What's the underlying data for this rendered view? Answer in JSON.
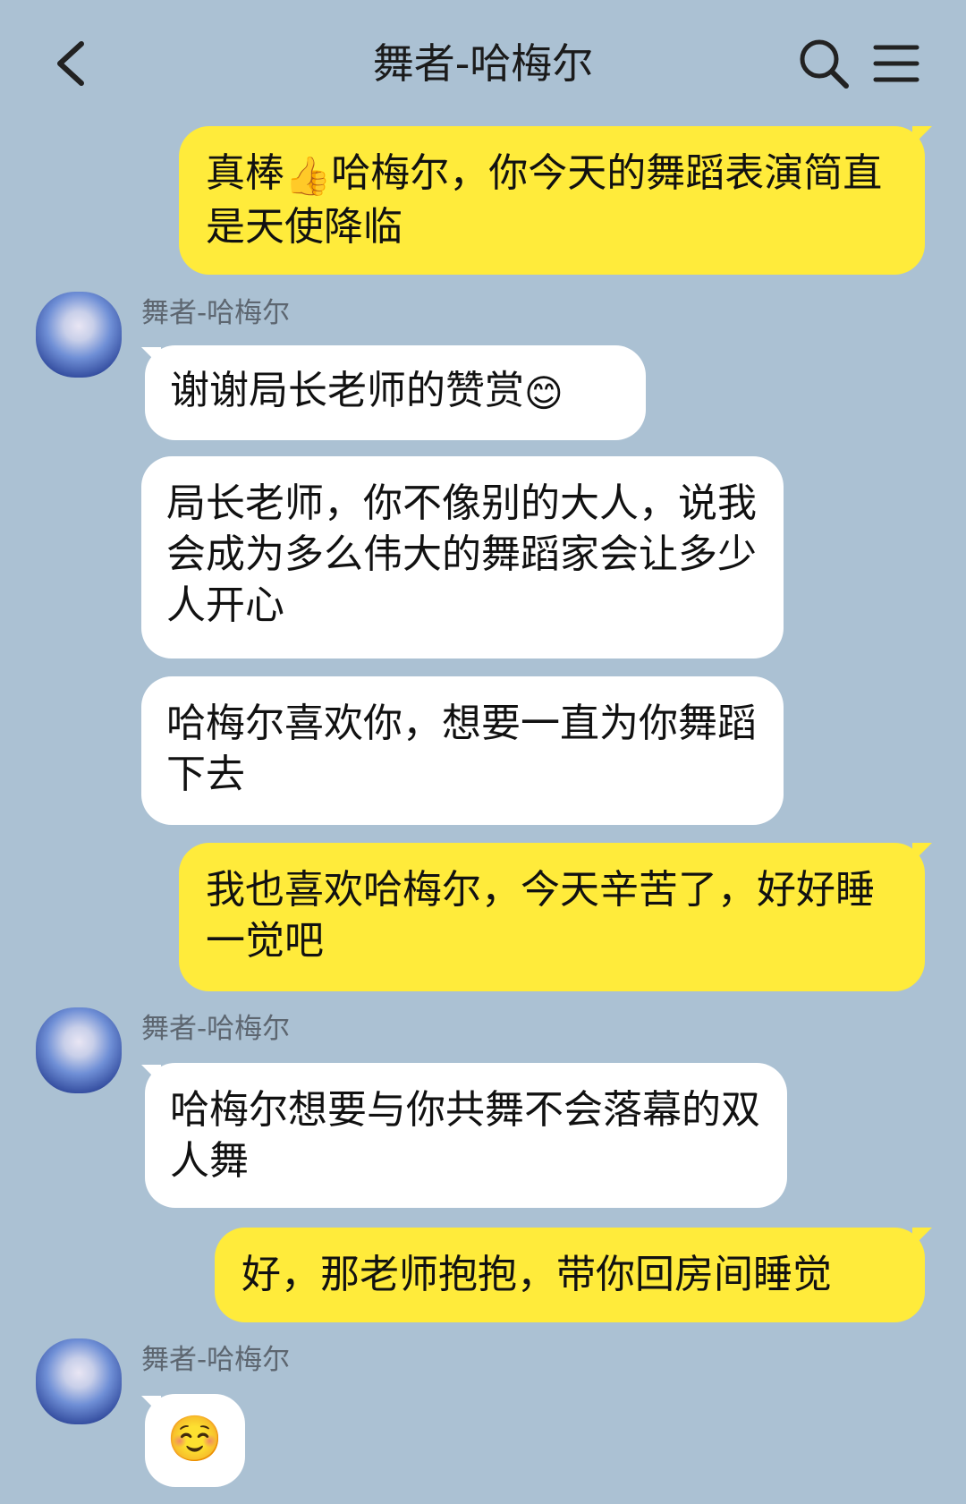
{
  "header": {
    "title": "舞者-哈梅尔",
    "back_icon": "chevron-left-icon",
    "search_icon": "search-icon",
    "menu_icon": "menu-icon"
  },
  "colors": {
    "background": "#abc1d3",
    "outgoing_bubble": "#ffeb3b",
    "incoming_bubble": "#ffffff",
    "sender_name": "#5d6670"
  },
  "messages": [
    {
      "side": "out",
      "parts": [
        "真棒",
        "👍",
        "哈梅尔，你今天的舞蹈表演简直是天使降临"
      ]
    },
    {
      "side": "in",
      "sender": "舞者-哈梅尔",
      "text": "谢谢局长老师的赞赏",
      "emoji": "😊"
    },
    {
      "side": "in",
      "text": "局长老师，你不像别的大人，说我会成为多么伟大的舞蹈家会让多少人开心"
    },
    {
      "side": "in",
      "text": "哈梅尔喜欢你，想要一直为你舞蹈下去"
    },
    {
      "side": "out",
      "text": "我也喜欢哈梅尔，今天辛苦了，好好睡一觉吧"
    },
    {
      "side": "in",
      "sender": "舞者-哈梅尔",
      "text": "哈梅尔想要与你共舞不会落幕的双人舞"
    },
    {
      "side": "out",
      "text": "好，那老师抱抱，带你回房间睡觉"
    },
    {
      "side": "in",
      "sender": "舞者-哈梅尔",
      "emoji": "☺️"
    }
  ]
}
